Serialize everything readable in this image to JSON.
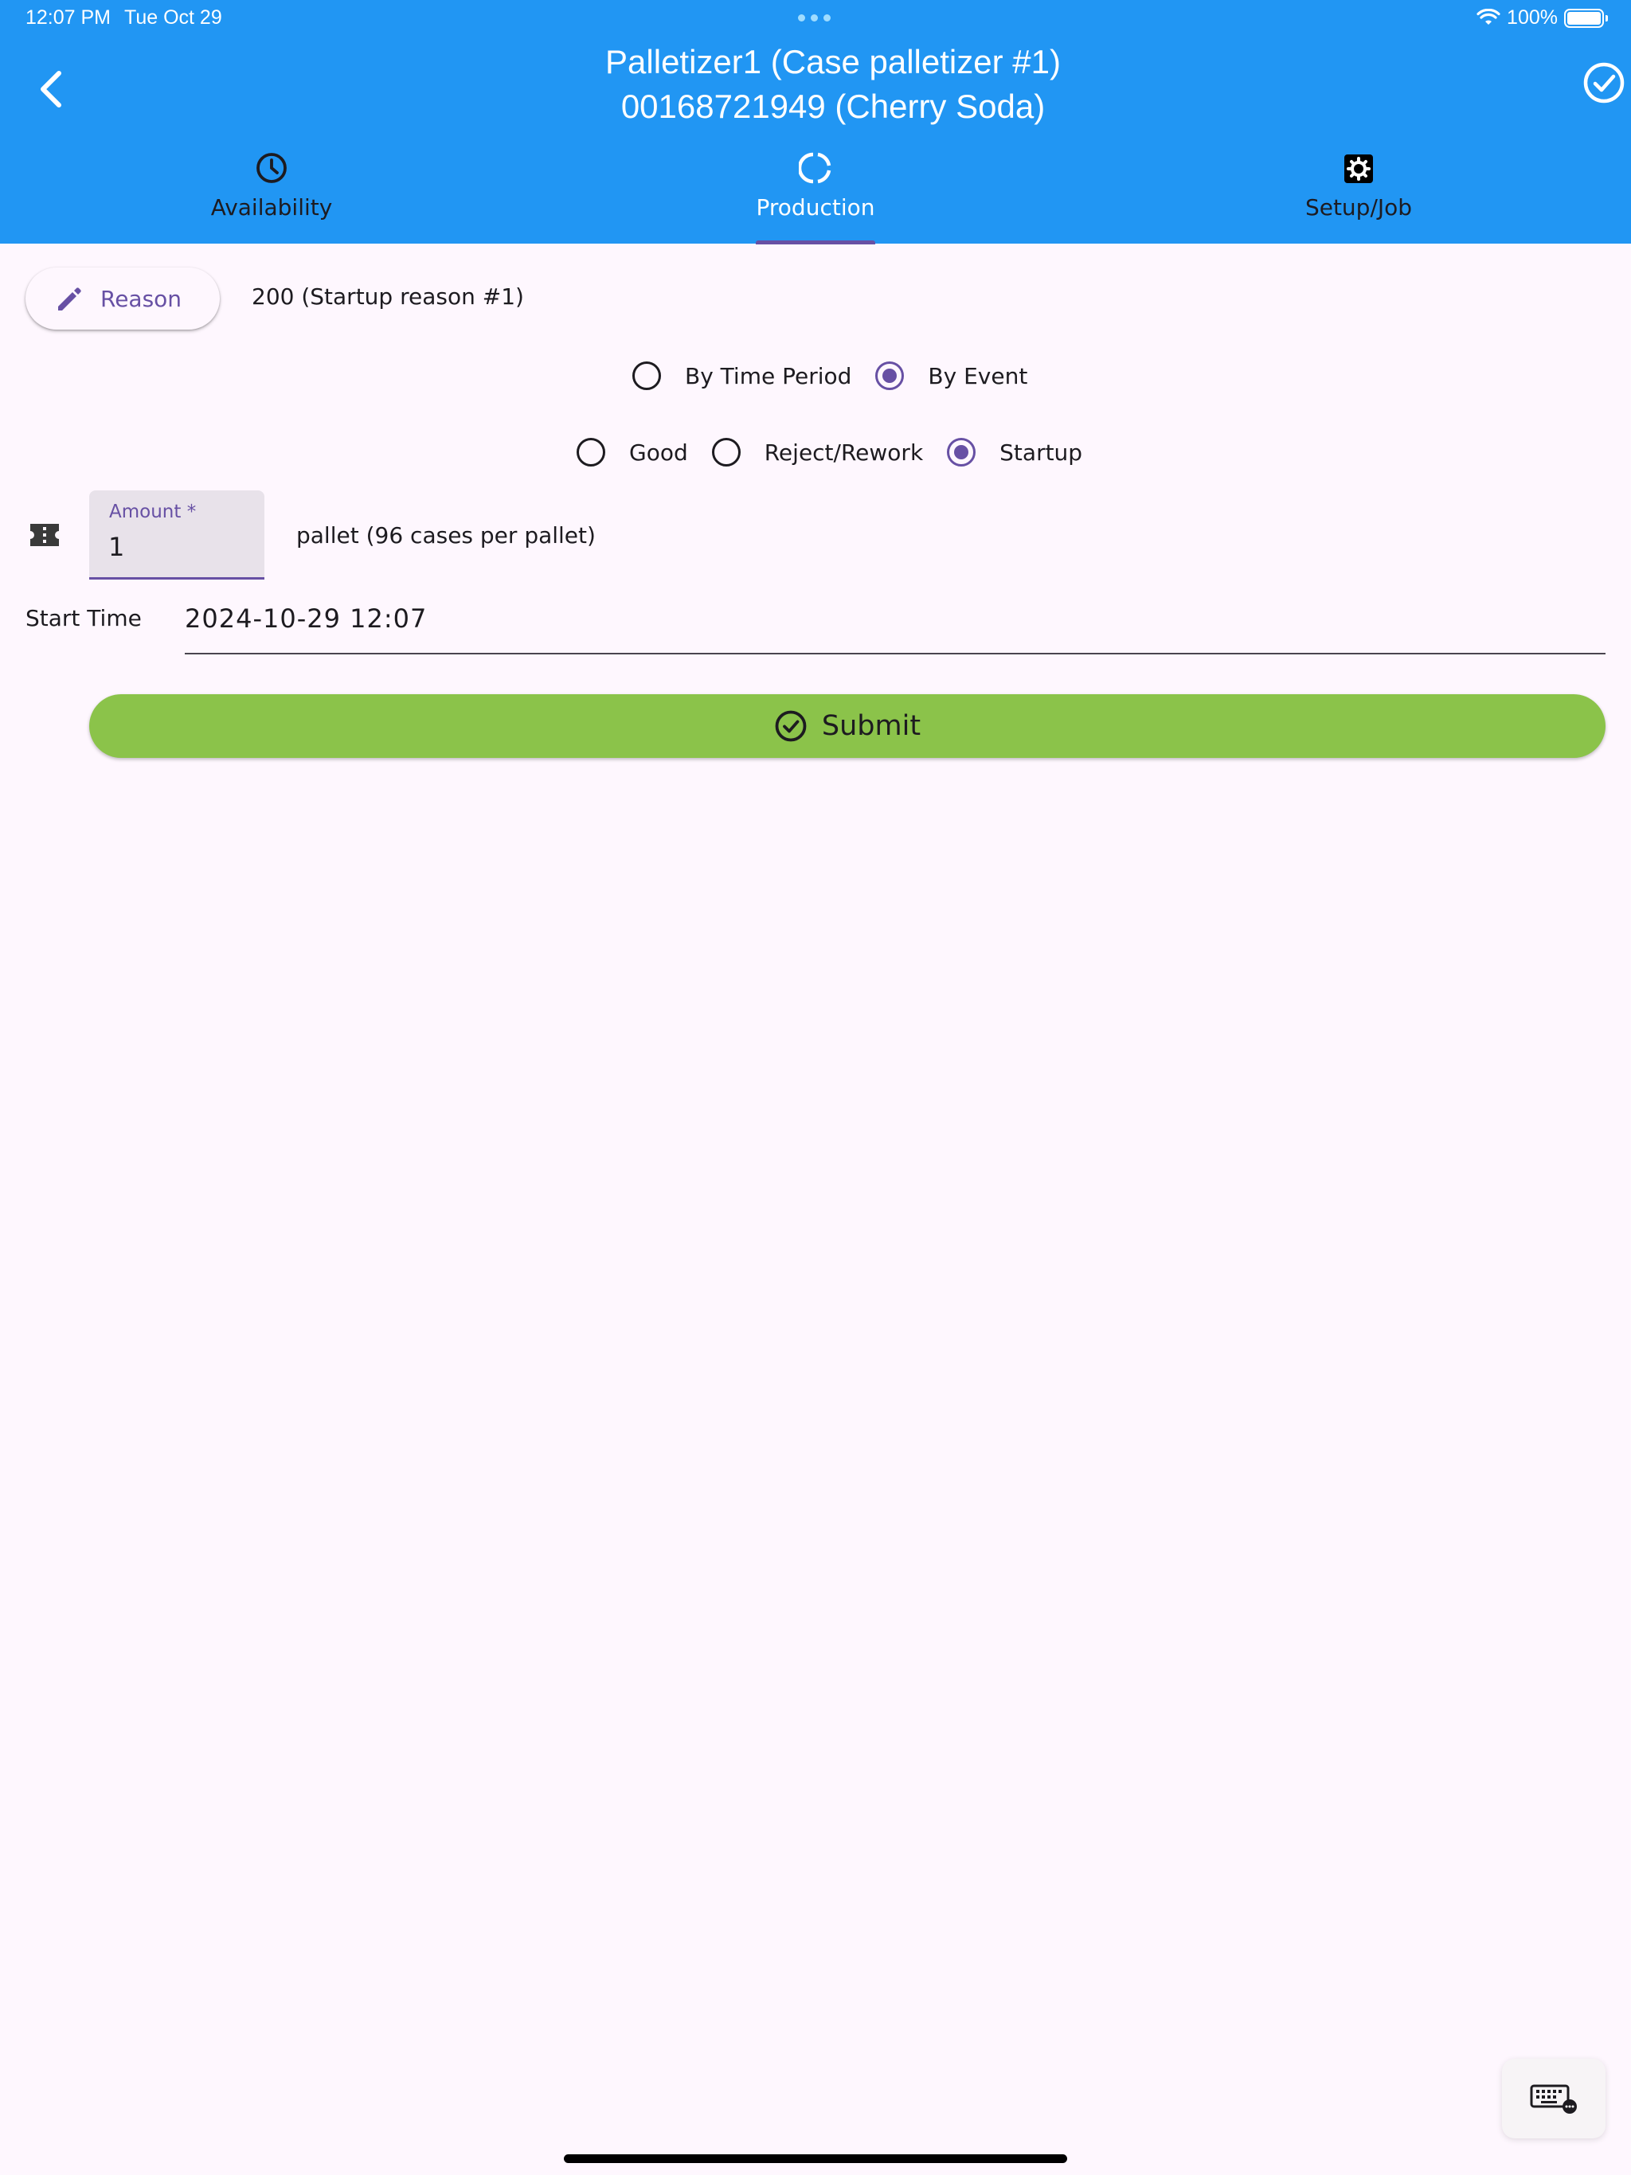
{
  "status_bar": {
    "time": "12:07 PM",
    "date": "Tue Oct 29",
    "battery": "100%"
  },
  "header": {
    "title_line1": "Palletizer1 (Case palletizer #1)",
    "title_line2": "00168721949 (Cherry Soda)"
  },
  "tabs": [
    {
      "label": "Availability",
      "icon": "clock-icon"
    },
    {
      "label": "Production",
      "icon": "progress-ring-icon",
      "active": true
    },
    {
      "label": "Setup/Job",
      "icon": "settings-box-icon"
    }
  ],
  "reason": {
    "button_label": "Reason",
    "value": "200 (Startup reason #1)"
  },
  "mode_options": [
    {
      "label": "By Time Period",
      "checked": false
    },
    {
      "label": "By Event",
      "checked": true
    }
  ],
  "type_options": [
    {
      "label": "Good",
      "checked": false
    },
    {
      "label": "Reject/Rework",
      "checked": false
    },
    {
      "label": "Startup",
      "checked": true
    }
  ],
  "amount": {
    "label": "Amount *",
    "value": "1",
    "unit_text": "pallet (96 cases per pallet)"
  },
  "start_time": {
    "label": "Start Time",
    "value": "2024-10-29 12:07"
  },
  "submit": {
    "label": "Submit"
  },
  "colors": {
    "appbar": "#2196f3",
    "accent": "#6750a4",
    "submit": "#8bc34a",
    "background": "#fef7fe"
  }
}
